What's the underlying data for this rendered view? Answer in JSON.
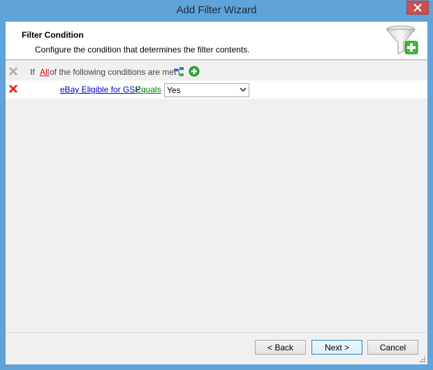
{
  "window": {
    "title": "Add Filter Wizard"
  },
  "header": {
    "title": "Filter Condition",
    "description": "Configure the condition that determines the filter contents.",
    "icon": "funnel-add-icon"
  },
  "group_row": {
    "prefix": "If",
    "mode_link": "All",
    "suffix": "of the following conditions are met"
  },
  "condition": {
    "field": "eBay Eligible for GSP",
    "operator": "Equals",
    "value": "Yes"
  },
  "buttons": {
    "back": "< Back",
    "next": "Next >",
    "cancel": "Cancel"
  },
  "colors": {
    "titlebar": "#5fa3d8",
    "client_bg": "#f0f0f0",
    "link_blue": "#0000cc",
    "link_green": "#008000",
    "link_red": "#e00000"
  }
}
